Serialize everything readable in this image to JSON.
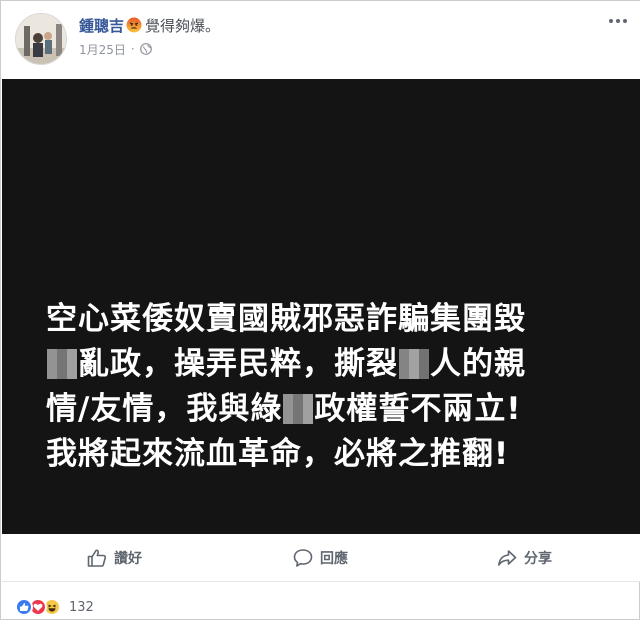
{
  "post": {
    "author": "鍾聰吉",
    "feeling": "覺得夠爆。",
    "date": "1月25日",
    "meta_separator": "·",
    "image_text": {
      "line1": "空心菜倭奴賣國賊邪惡詐騙集團毀",
      "line2_a": "亂政，操弄民粹，撕裂",
      "line2_b": "人的親",
      "line3_a": "情/友情，我與綠",
      "line3_b": "政權誓不兩立!",
      "line4": "我將起來流血革命，必將之推翻!"
    }
  },
  "actions": {
    "like": "讚好",
    "comment": "回應",
    "share": "分享"
  },
  "reactions": {
    "count": "132",
    "types": [
      "like-icon",
      "love-icon",
      "haha-icon"
    ]
  },
  "icons": {
    "feeling": "angry-emoji-icon",
    "privacy": "globe-icon",
    "menu": "more-options-icon"
  },
  "colors": {
    "author": "#365899",
    "image_bg": "#141414",
    "like_blue": "#3b7bf0",
    "love_red": "#f0364d",
    "haha_yellow": "#f7c847"
  }
}
